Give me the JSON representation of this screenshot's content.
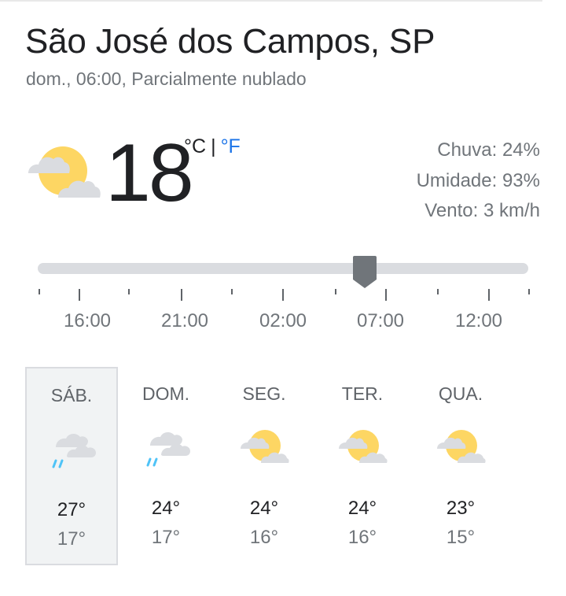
{
  "header": {
    "location": "São José dos Campos, SP",
    "subtitle": "dom., 06:00, Parcialmente nublado"
  },
  "current": {
    "temperature": "18",
    "unit_celsius": "°C",
    "unit_separator": "|",
    "unit_fahrenheit": "°F",
    "icon": "partly-cloudy-icon",
    "details": [
      {
        "text": "Chuva: 24%"
      },
      {
        "text": "Umidade: 93%"
      },
      {
        "text": "Vento: 3 km/h"
      }
    ]
  },
  "timeline": {
    "tick_labels": [
      "16:00",
      "21:00",
      "02:00",
      "07:00",
      "12:00"
    ],
    "selected_time": "06:00"
  },
  "forecast": [
    {
      "day": "SÁB.",
      "high": "27°",
      "low": "17°",
      "icon": "rain-cloud-icon",
      "selected": true
    },
    {
      "day": "DOM.",
      "high": "24°",
      "low": "17°",
      "icon": "rain-cloud-icon",
      "selected": false
    },
    {
      "day": "SEG.",
      "high": "24°",
      "low": "16°",
      "icon": "partly-cloudy-icon",
      "selected": false
    },
    {
      "day": "TER.",
      "high": "24°",
      "low": "16°",
      "icon": "partly-cloudy-icon",
      "selected": false
    },
    {
      "day": "QUA.",
      "high": "23°",
      "low": "15°",
      "icon": "partly-cloudy-icon",
      "selected": false
    }
  ],
  "colors": {
    "link_blue": "#1a73e8",
    "sun_yellow": "#fdd663",
    "cloud_gray": "#dadce0",
    "rain_blue": "#4fc3f7"
  }
}
